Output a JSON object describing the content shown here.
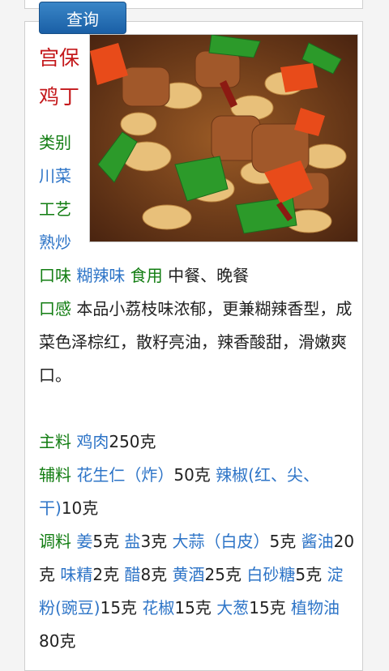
{
  "search": {
    "button_label": "查询"
  },
  "dish": {
    "title_line1": "宫保",
    "title_line2": "鸡丁",
    "category_label": "类别",
    "category_value": "川菜",
    "technique_label": "工艺",
    "technique_value": "熟炒",
    "flavor_label": "口味",
    "flavor_value": "糊辣味",
    "meal_label": "食用",
    "meal_value": "中餐、晚餐",
    "taste_label": "口感",
    "taste_text": "本品小荔枝味浓郁，更兼糊辣香型，成菜色泽棕红，散籽亮油，辣香酸甜，滑嫩爽口。"
  },
  "ingredients": {
    "main_label": "主料",
    "main": [
      {
        "name": "鸡肉",
        "qty": "250克"
      }
    ],
    "aux_label": "辅料",
    "aux": [
      {
        "name": "花生仁（炸）",
        "qty": "50克"
      },
      {
        "name": "辣椒(红、尖、干)",
        "qty": "10克"
      }
    ],
    "seasoning_label": "调料",
    "seasoning": [
      {
        "name": "姜",
        "qty": "5克"
      },
      {
        "name": "盐",
        "qty": "3克"
      },
      {
        "name": "大蒜（白皮）",
        "qty": "5克"
      },
      {
        "name": "酱油",
        "qty": "20克"
      },
      {
        "name": "味精",
        "qty": "2克"
      },
      {
        "name": "醋",
        "qty": "8克"
      },
      {
        "name": "黄酒",
        "qty": "25克"
      },
      {
        "name": "白砂糖",
        "qty": "5克"
      },
      {
        "name": "淀粉(豌豆)",
        "qty": "15克"
      },
      {
        "name": "花椒",
        "qty": "15克"
      },
      {
        "name": "大葱",
        "qty": "15克"
      },
      {
        "name": "植物油",
        "qty": "80克"
      }
    ]
  },
  "colors": {
    "label_green": "#127d12",
    "link_blue": "#2d74c7",
    "title_red": "#c4181b",
    "button_blue": "#1a5fa6"
  }
}
